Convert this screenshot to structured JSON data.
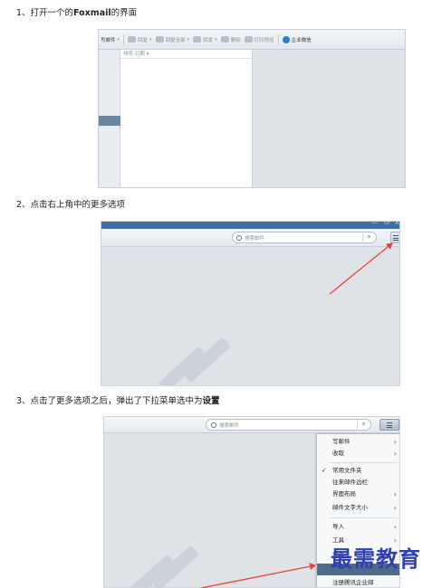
{
  "steps": {
    "step1_prefix": "1、打开一个的",
    "step1_bold": "Foxmail",
    "step1_suffix": "的界面",
    "step2": "2、点击右上角中的更多选项",
    "step3_prefix": "3、点击了更多选项之后，弹出了下拉菜单选中为",
    "step3_bold": "设置"
  },
  "shot1": {
    "toolbar": {
      "compose": "写邮件",
      "reply": "回复",
      "reply_all": "回复全部",
      "forward": "转发",
      "delete": "删除",
      "print_preview": "打印预览",
      "enterprise": "企业微信"
    },
    "list_header": "排序:日期"
  },
  "shot2": {
    "window_controls": {
      "minimize": "—",
      "restore": "▭",
      "close": "X"
    },
    "search_placeholder": "搜索邮件"
  },
  "shot3": {
    "search_placeholder": "搜索邮件",
    "menu": [
      {
        "label": "写邮件",
        "arrow": "›"
      },
      {
        "label": "收取",
        "arrow": "›"
      },
      {
        "label": "常用文件夹",
        "check": "✓"
      },
      {
        "label": "往来邮件边栏"
      },
      {
        "label": "界面布局",
        "arrow": "›"
      },
      {
        "label": "邮件文字大小",
        "arrow": "›"
      },
      {
        "label": "导入",
        "arrow": "›"
      },
      {
        "label": "工具",
        "arrow": "›"
      },
      {
        "label": "设置"
      },
      {
        "label": ""
      },
      {
        "label": "注册腾讯企业邮"
      }
    ]
  },
  "watermark_brand": "最需教育",
  "colors": {
    "arrow": "#e8413c",
    "brand": "#2e3fb0",
    "menu_selected": "#4f6b8a"
  }
}
